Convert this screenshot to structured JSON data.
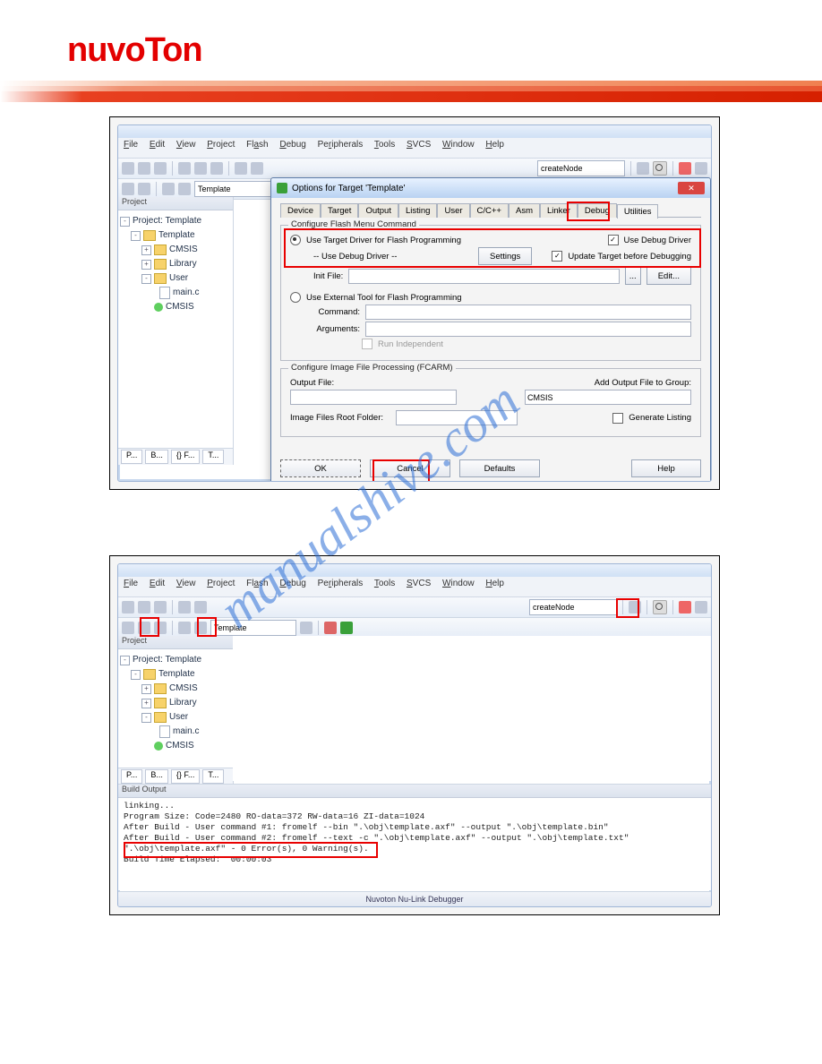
{
  "brand": "nuvoTon",
  "menu": [
    "File",
    "Edit",
    "View",
    "Project",
    "Flash",
    "Debug",
    "Peripherals",
    "Tools",
    "SVCS",
    "Window",
    "Help"
  ],
  "toolbar": {
    "target_label": "Template",
    "search_value": "createNode"
  },
  "project": {
    "pane_title": "Project",
    "root": "Project: Template",
    "target": "Template",
    "groups": [
      "CMSIS",
      "Library",
      "User"
    ],
    "user_files": [
      "main.c",
      "CMSIS"
    ],
    "tabs": [
      "P...",
      "B...",
      "{} F...",
      "T..."
    ]
  },
  "dialog": {
    "title": "Options for Target 'Template'",
    "tabs": [
      "Device",
      "Target",
      "Output",
      "Listing",
      "User",
      "C/C++",
      "Asm",
      "Linker",
      "Debug",
      "Utilities"
    ],
    "active_tab": "Utilities",
    "group1_title": "Configure Flash Menu Command",
    "opt_use_target_driver": "Use Target Driver for Flash Programming",
    "use_debug_driver_label": "-- Use Debug Driver --",
    "settings_btn": "Settings",
    "cb_use_debug_driver": "Use Debug Driver",
    "cb_update_target": "Update Target before Debugging",
    "init_file_label": "Init File:",
    "edit_btn": "Edit...",
    "opt_external": "Use External Tool for Flash Programming",
    "command_label": "Command:",
    "arguments_label": "Arguments:",
    "run_independent": "Run Independent",
    "group2_title": "Configure Image File Processing (FCARM)",
    "output_file_label": "Output File:",
    "add_output_label": "Add Output File to Group:",
    "group_select_value": "CMSIS",
    "image_root_label": "Image Files Root Folder:",
    "generate_listing": "Generate Listing",
    "ok": "OK",
    "cancel": "Cancel",
    "defaults": "Defaults",
    "help": "Help"
  },
  "build_output": {
    "title": "Build Output",
    "lines": [
      "linking...",
      "Program Size: Code=2480 RO-data=372 RW-data=16 ZI-data=1024",
      "After Build - User command #1: fromelf --bin \".\\obj\\template.axf\" --output \".\\obj\\template.bin\"",
      "After Build - User command #2: fromelf --text -c \".\\obj\\template.axf\" --output \".\\obj\\template.txt\"",
      "\".\\obj\\template.axf\" - 0 Error(s), 0 Warning(s).",
      "Build Time Elapsed:  00:00:03"
    ]
  },
  "status_bar": "Nuvoton Nu-Link Debugger",
  "watermark": "manualshive.com"
}
